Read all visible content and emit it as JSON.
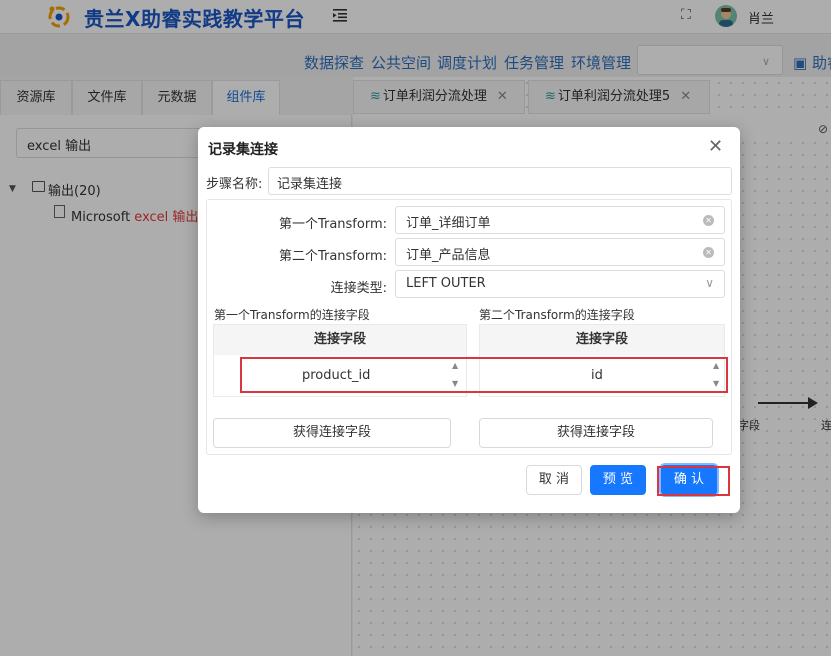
{
  "header": {
    "title": "贵兰X助睿实践教学平台",
    "fullscreen_glyph": "⛶",
    "user": "肖兰",
    "brand_color": "#1a57c7"
  },
  "nav": {
    "links": [
      "数据探查",
      "公共空间",
      "调度计划",
      "任务管理",
      "环境管理"
    ],
    "extra": "▣ 助睿"
  },
  "left_panel": {
    "tabs": [
      "资源库",
      "文件库",
      "元数据",
      "组件库"
    ],
    "active_tab": "组件库",
    "search_value": "excel 输出",
    "tree": {
      "folder": "输出(20)",
      "leaf_prefix": "Microsoft ",
      "leaf_highlight": "excel 输出"
    }
  },
  "workspace": {
    "tabs": [
      {
        "label": "订单利润分流处理",
        "icon": "wave-icon"
      },
      {
        "label": "订单利润分流处理5",
        "icon": "wave-icon"
      }
    ],
    "canvas_labels": [
      "字段",
      "连"
    ]
  },
  "dialog": {
    "title": "记录集连接",
    "step_name_label": "步骤名称:",
    "step_name_value": "记录集连接",
    "first_transform_label": "第一个Transform:",
    "first_transform_value": "订单_详细订单",
    "second_transform_label": "第二个Transform:",
    "second_transform_value": "订单_产品信息",
    "join_type_label": "连接类型:",
    "join_type_value": "LEFT OUTER",
    "first_fields_caption": "第一个Transform的连接字段",
    "second_fields_caption": "第二个Transform的连接字段",
    "field_column_header": "连接字段",
    "first_field_value": "product_id",
    "second_field_value": "id",
    "fetch_fields_label": "获得连接字段",
    "cancel": "取 消",
    "preview": "预 览",
    "confirm": "确 认",
    "primary_color": "#1677ff",
    "highlight_color": "#d9363e"
  }
}
